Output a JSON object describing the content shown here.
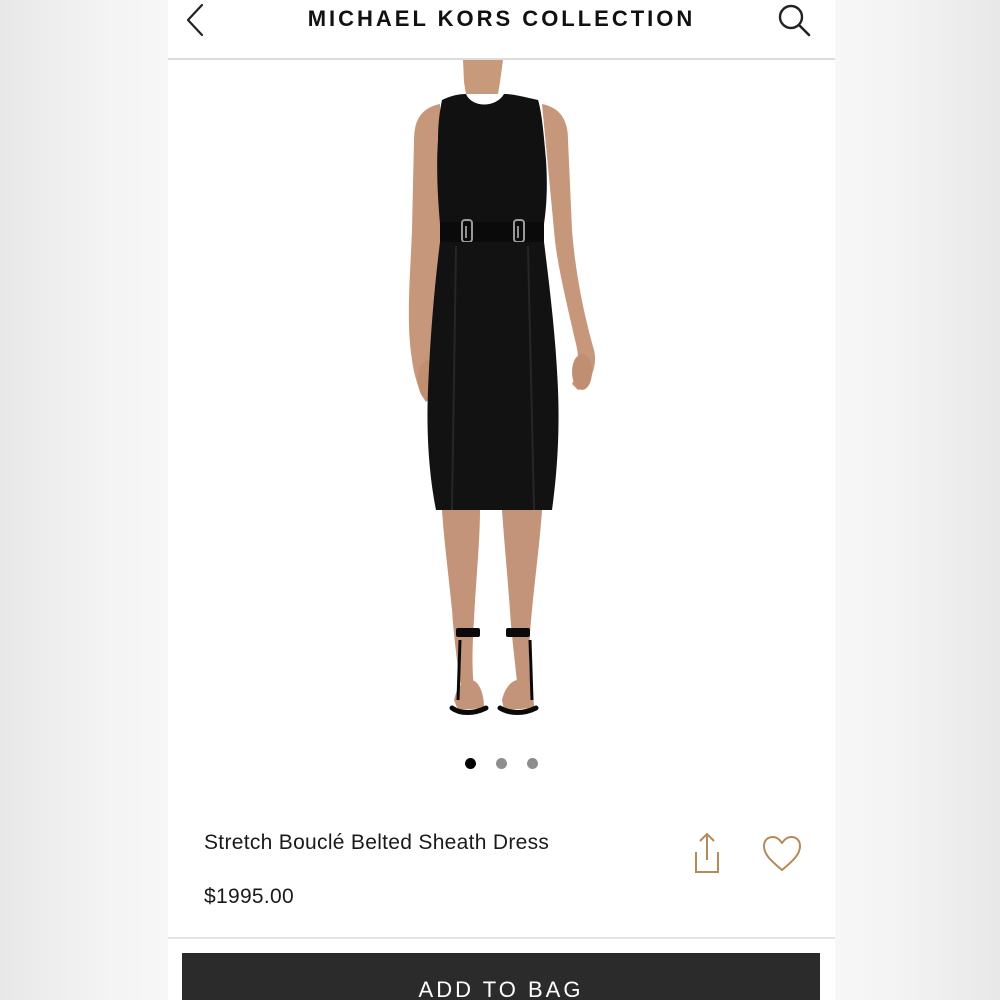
{
  "header": {
    "title": "MICHAEL KORS COLLECTION",
    "back_icon": "chevron-left-icon",
    "search_icon": "search-icon"
  },
  "product": {
    "name": "Stretch Bouclé Belted Sheath Dress",
    "price": "$1995.00",
    "image_alt": "Black sleeveless belted sheath dress with black ankle-strap sandals",
    "carousel": {
      "total": 3,
      "active": 1
    }
  },
  "actions": {
    "share_icon": "share-icon",
    "favorite_icon": "heart-icon",
    "add_to_bag_label": "ADD TO BAG"
  },
  "colors": {
    "icon_accent": "#b5895a",
    "button_bg": "#2b2b2b",
    "dress": "#111111"
  }
}
